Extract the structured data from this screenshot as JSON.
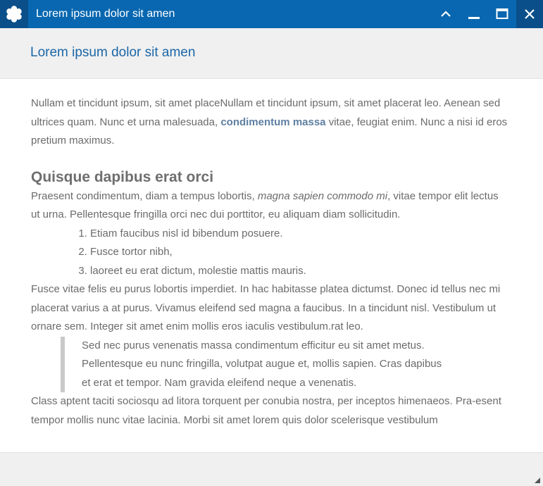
{
  "window": {
    "title": "Lorem ipsum dolor sit amen",
    "buttons": {
      "collapse_icon": "chevron-up-icon",
      "minimize_icon": "minimize-icon",
      "maximize_icon": "maximize-icon",
      "close_icon": "close-icon"
    }
  },
  "header": {
    "title": "Lorem ipsum dolor sit amen"
  },
  "content": {
    "intro": {
      "before": "Nullam et tincidunt ipsum, sit amet placeNullam et tincidunt ipsum, sit amet placerat leo. Aenean sed ultrices quam. Nunc et urna malesuada, ",
      "bold": "condimentum massa",
      "after": " vitae, feugiat enim. Nunc a nisi id eros pretium maximus."
    },
    "heading": "Quisque dapibus erat orci",
    "para2": {
      "before": "Praesent condimentum, diam a tempus lobortis, ",
      "italic": "magna sapien commodo mi",
      "after": ", vitae tempor elit lectus ut urna. Pellentesque fringilla orci nec dui porttitor, eu aliquam diam sollicitudin."
    },
    "list": [
      "Etiam faucibus nisl id bibendum posuere.",
      "Fusce tortor nibh,",
      "laoreet eu erat dictum, molestie mattis mauris."
    ],
    "para3": "Fusce vitae felis eu purus lobortis imperdiet. In hac habitasse platea dictumst. Donec id tellus nec mi placerat varius a at purus. Vivamus eleifend sed magna a faucibus. In a tincidunt nisl. Vestibulum ut ornare sem. Integer sit amet enim mollis eros iaculis vestibulum.rat leo.",
    "quote": [
      "Sed nec purus venenatis massa condimentum efficitur eu sit amet metus.",
      "Pellentesque eu nunc fringilla, volutpat augue et, mollis sapien. Cras dapibus",
      "et erat et tempor. Nam gravida eleifend neque a venenatis."
    ],
    "para4": "Class aptent taciti sociosqu ad litora torquent per conubia nostra, per inceptos himenaeos. Pra-esent tempor mollis nunc vitae lacinia. Morbi sit amet lorem quis dolor scelerisque vestibulum"
  },
  "colors": {
    "titlebar": "#0867b0",
    "titlebar_dark": "#0a4f8a",
    "header_text": "#1a67a8",
    "body_text": "#6b6b6b",
    "link": "#5e7fa1"
  }
}
